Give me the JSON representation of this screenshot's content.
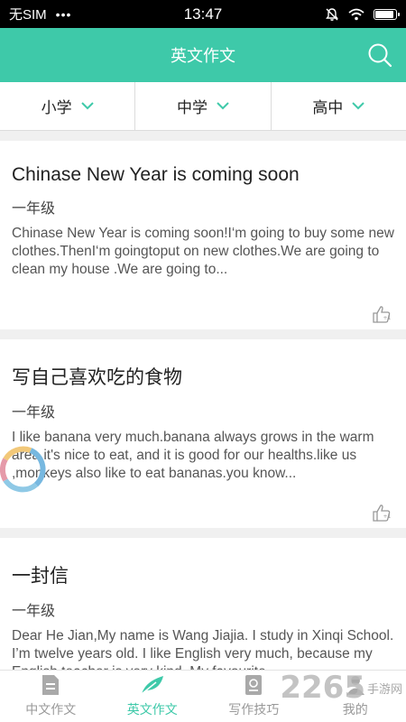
{
  "status_bar": {
    "carrier": "无SIM",
    "time": "13:47",
    "battery_level": 0.9
  },
  "header": {
    "title": "英文作文"
  },
  "filters": [
    {
      "label": "小学"
    },
    {
      "label": "中学"
    },
    {
      "label": "高中"
    }
  ],
  "articles": [
    {
      "title": "Chinase New Year is coming soon",
      "grade": "一年级",
      "excerpt": "Chinase New Year is coming soon!I‘m going to buy some new clothes.ThenI‘m goingtoput on new clothes.We are going to clean my house .We are going to..."
    },
    {
      "title": "写自己喜欢吃的食物",
      "grade": "一年级",
      "excerpt": "I like banana very much.banana always grows in the warm area.it's nice to eat, and it is good for our healths.like us ,monkeys also like to eat bananas.you know..."
    },
    {
      "title": "一封信",
      "grade": "一年级",
      "excerpt": "Dear He Jian,My name is Wang Jiajia. I study in Xinqi School. I’m twelve years old. I like English very much, because my English teacher is very kind. My favourite..."
    }
  ],
  "tabs": [
    {
      "label": "中文作文",
      "icon": "document-icon",
      "active": false
    },
    {
      "label": "英文作文",
      "icon": "feather-icon",
      "active": true
    },
    {
      "label": "写作技巧",
      "icon": "book-icon",
      "active": false
    },
    {
      "label": "我的",
      "icon": "person-icon",
      "active": false
    }
  ],
  "watermark": {
    "number": "2265",
    "site": "手游网"
  },
  "colors": {
    "accent": "#3ec9a9",
    "status_bar": "#000000"
  }
}
